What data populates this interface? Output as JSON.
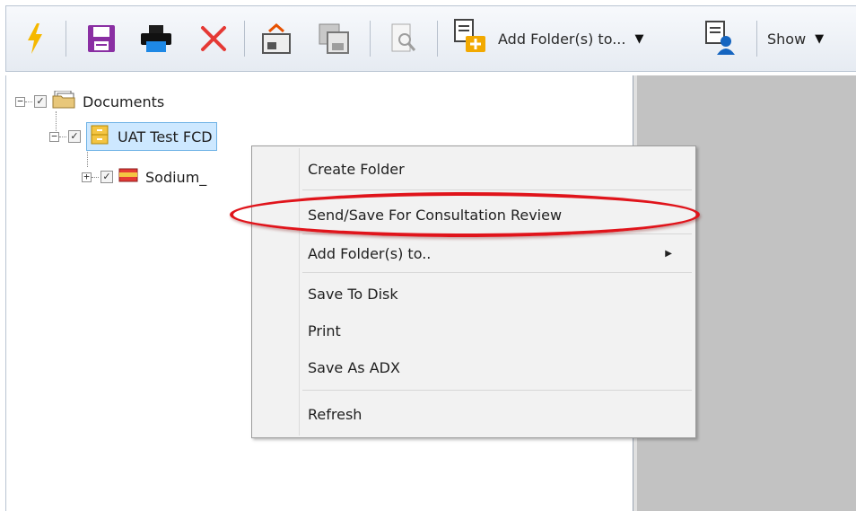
{
  "toolbar": {
    "add_folders_label": "Add Folder(s) to...",
    "show_label": "Show",
    "icons": [
      "lightning-icon",
      "save-icon",
      "print-icon",
      "delete-icon",
      "import-icon",
      "copy-save-icon",
      "preview-icon",
      "add-folder-icon",
      "assign-user-icon"
    ]
  },
  "tree": {
    "root": {
      "label": "Documents"
    },
    "child": {
      "label": "UAT Test FCD"
    },
    "grandchild": {
      "label": "Sodium_"
    }
  },
  "context_menu": {
    "items": [
      {
        "label": "Create Folder"
      },
      {
        "label": "Send/Save For Consultation Review"
      },
      {
        "label": "Add Folder(s) to.."
      },
      {
        "label": "Save To Disk"
      },
      {
        "label": "Print"
      },
      {
        "label": "Save As ADX"
      },
      {
        "label": "Refresh"
      }
    ]
  },
  "colors": {
    "highlight_oval": "#e0141b",
    "selection": "#cde8ff",
    "preview_bg": "#c2c2c2"
  }
}
